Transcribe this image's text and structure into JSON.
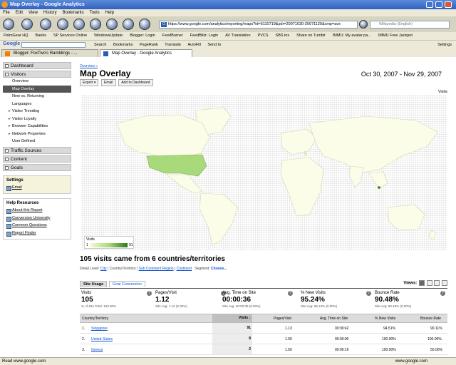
{
  "window": {
    "title": "Map Overlay - Google Analytics"
  },
  "menu": [
    "File",
    "Edit",
    "View",
    "History",
    "Bookmarks",
    "Tools",
    "Help"
  ],
  "browser": {
    "url": "https://www.google.com/analytics/reporting/maps?id=5110719&pdr=20071030-20071129&cmp=ave",
    "search_placeholder": "Wikipedia (English)"
  },
  "bookmarks": [
    "PalmGear HQ",
    "Banks",
    "SP Services Online",
    "WindowsUpdate",
    "Blogger: Login",
    "FeedBurner",
    "FeedBlitz: Login",
    "AV Translation",
    "PVCS",
    "SBS ins",
    "Share on Tumblr",
    "IMMU: My avatar pa...",
    "IMMU Free Jackpot"
  ],
  "googlebar": {
    "logo": "Google",
    "search_label": "Search",
    "items": [
      "Bookmarks",
      "PageRank",
      "Translate",
      "AutoFill",
      "Send to"
    ],
    "settings": "Settings"
  },
  "tabs": [
    {
      "label": "Blogger: FoxTwo's Ramblings - ..."
    },
    {
      "label": "Map Overlay - Google Analytics"
    }
  ],
  "sidebar": {
    "sections": [
      {
        "label": "Dashboard"
      },
      {
        "label": "Visitors"
      }
    ],
    "visitor_items": [
      "Overview",
      "Map Overlay",
      "New vs. Returning",
      "Languages",
      "Visitor Trending",
      "Visitor Loyalty",
      "Browser Capabilities",
      "Network Properties",
      "User Defined"
    ],
    "other_sections": [
      "Traffic Sources",
      "Content",
      "Goals"
    ],
    "settings": {
      "title": "Settings",
      "links": [
        "Email"
      ]
    },
    "help": {
      "title": "Help Resources",
      "links": [
        "About this Report",
        "Conversion University",
        "Common Questions",
        "Report Finder"
      ]
    }
  },
  "report": {
    "breadcrumb": "Overview »",
    "title": "Map Overlay",
    "date_range": "Oct 30, 2007 - Nov 29, 2007",
    "buttons": [
      "Export ▾",
      "Email",
      "Add to Dashboard"
    ],
    "map_metric": "Visits",
    "legend": {
      "title": "Visits",
      "min": "1",
      "max": "91"
    },
    "summary": "105 visits came from 6 countries/territories",
    "detail_label": "Detail Level:",
    "detail_levels": [
      "City",
      "Country/Territory",
      "Sub Continent Region",
      "Continent"
    ],
    "segment_label": "Segment:",
    "segment_value": "Choose...",
    "report_tabs": [
      "Site Usage",
      "Goal Conversion"
    ],
    "views_label": "Views:",
    "stats": [
      {
        "label": "Visits",
        "value": "105",
        "sub": "% of Site Total: 100.00%"
      },
      {
        "label": "Pages/Visit",
        "value": "1.12",
        "sub": "Site Avg: 1.12 (0.00%)"
      },
      {
        "label": "Avg. Time on Site",
        "value": "00:00:36",
        "sub": "Site Avg: 00:00:36 (0.00%)"
      },
      {
        "label": "% New Visits",
        "value": "95.24%",
        "sub": "Site Avg: 95.24% (0.00%)"
      },
      {
        "label": "Bounce Rate",
        "value": "90.48%",
        "sub": "Site Avg: 90.48% (0.00%)"
      }
    ],
    "table": {
      "headers": [
        "Country/Territory",
        "Visits ↓",
        "Pages/Visit",
        "Avg. Time on Site",
        "% New Visits",
        "Bounce Rate"
      ],
      "rows": [
        {
          "idx": "1.",
          "country": "Singapore",
          "visits": "91",
          "pages": "1.13",
          "time": "00:00:42",
          "new": "94.51%",
          "bounce": "90.11%"
        },
        {
          "idx": "2.",
          "country": "United States",
          "visits": "8",
          "pages": "1.00",
          "time": "00:00:00",
          "new": "100.00%",
          "bounce": "100.00%"
        },
        {
          "idx": "3.",
          "country": "Greece",
          "visits": "2",
          "pages": "1.50",
          "time": "00:00:16",
          "new": "100.00%",
          "bounce": "50.00%"
        }
      ]
    }
  },
  "status": {
    "text": "Read www.google.com",
    "right": "www.google.com"
  },
  "colors": {
    "accent": "#1155cc",
    "map_low": "#f0fbd8",
    "map_high": "#2a7a1a"
  }
}
